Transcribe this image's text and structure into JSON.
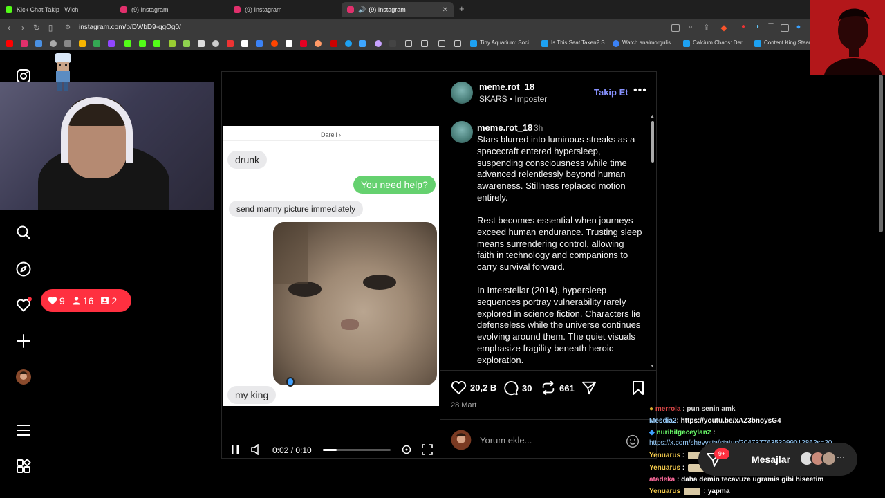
{
  "tabs": [
    {
      "label": "Kick Chat Takip | Wich",
      "favicon_color": "#53fc18"
    },
    {
      "label": "(9) Instagram",
      "favicon_color": "#e1306c"
    },
    {
      "label": "(9) Instagram",
      "favicon_color": "#e1306c"
    },
    {
      "label": "(9) Instagram",
      "favicon_color": "#e1306c",
      "active": true
    }
  ],
  "address": {
    "url": "instagram.com/p/DWbD9-qgQg0/"
  },
  "bookmarks": {
    "items": [
      "Tiny Aquarium: Soci...",
      "Is This Seat Taken? S...",
      "Watch analmorgulis...",
      "Calcium Chaos: Der...",
      "Content King Stear"
    ]
  },
  "stream": {
    "notifications": {
      "likes": "9",
      "followers": "16",
      "comments": "2"
    }
  },
  "video": {
    "timecode": "0:02 / 0:10",
    "progress": 0.2,
    "chat_screenshot": {
      "contact": "Darell ›",
      "messages": [
        {
          "text": "drunk",
          "side": "left"
        },
        {
          "text": "You need help?",
          "side": "right"
        },
        {
          "text": "send manny picture immediately",
          "side": "left"
        },
        {
          "text": "my king",
          "side": "left"
        }
      ]
    }
  },
  "post": {
    "author": "meme.rot_18",
    "audio": "SKARS • Imposter",
    "follow_label": "Takip Et",
    "more_label": "•••",
    "caption_time": "3h",
    "paragraphs": [
      "Stars blurred into luminous streaks as a spacecraft entered hypersleep, suspending consciousness while time advanced relentlessly beyond human awareness. Stillness replaced motion entirely.",
      "Rest becomes essential when journeys exceed human endurance. Trusting sleep means surrendering control, allowing faith in technology and companions to carry survival forward.",
      "In Interstellar (2014), hypersleep sequences portray vulnerability rarely explored in science fiction. Characters lie defenseless while the universe continues evolving around them. The quiet visuals emphasize fragility beneath heroic exploration."
    ],
    "likes": "20,2 B",
    "comments": "30",
    "reposts": "661",
    "date": "28 Mart",
    "comment_placeholder": "Yorum ekle..."
  },
  "chat_overlay": {
    "lines": [
      {
        "user": "merrola",
        "text": ": pun senin amk",
        "color": "#ff5555"
      },
      {
        "user": "Mesdia2",
        "text": ": https://youtu.be/xAZ3bnoysG4",
        "color": "#9ad0ff"
      },
      {
        "user": "nuribilgeceylan2",
        "text": ":",
        "color": "#6bff6b"
      },
      {
        "user": "",
        "text": "https://x.com/shevysta/status/2047377635399901286?s=20",
        "color": "#9ad0ff"
      },
      {
        "user": "Yenuarus",
        "text": ":",
        "color": "#f2c94c"
      },
      {
        "user": "Yenuarus",
        "text": ":",
        "color": "#f2c94c"
      },
      {
        "user": "atadeka",
        "text": ": daha demin tecavuze ugramis gibi hiseetim",
        "color": "#ff6b9d"
      },
      {
        "user": "Yenuarus",
        "text": ": yapma",
        "color": "#f2c94c"
      }
    ]
  },
  "messages_pill": {
    "label": "Mesajlar",
    "badge": "9+"
  },
  "colors": {
    "brand_red": "#ff3040",
    "follow_blue": "#8791ff",
    "bg": "#000000"
  }
}
